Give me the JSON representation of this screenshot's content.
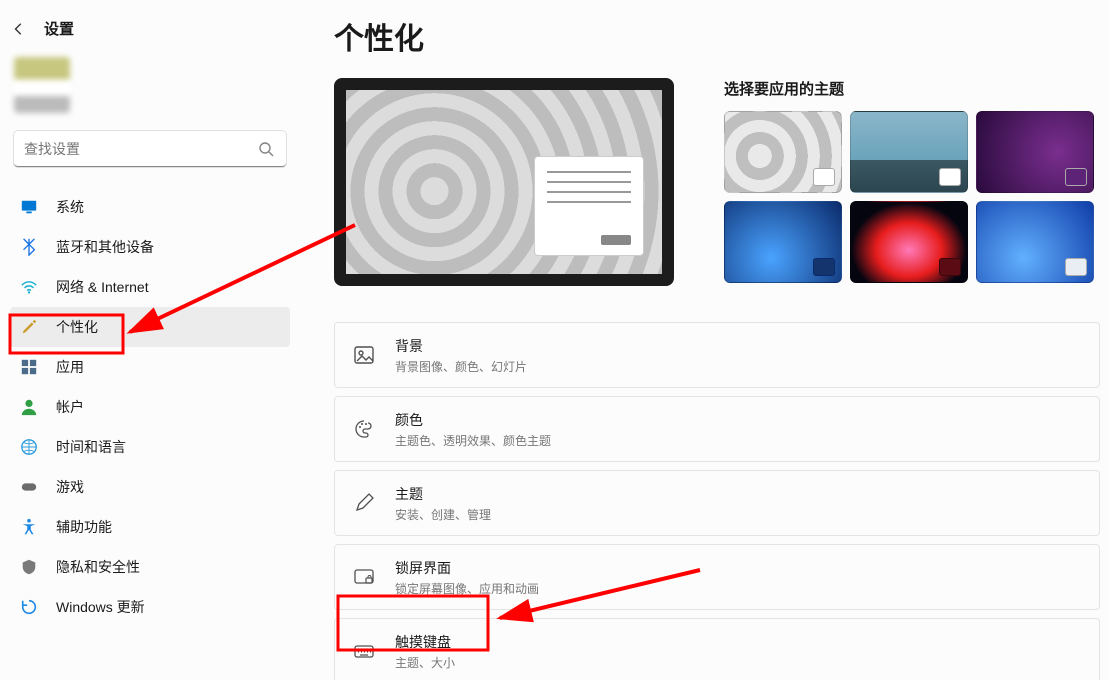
{
  "header": {
    "app_title": "设置"
  },
  "search": {
    "placeholder": "查找设置"
  },
  "sidebar": {
    "items": [
      {
        "key": "system",
        "label": "系统",
        "icon": "monitor-icon",
        "color": "#0078d4"
      },
      {
        "key": "bluetooth",
        "label": "蓝牙和其他设备",
        "icon": "bluetooth-icon",
        "color": "#1a73e8"
      },
      {
        "key": "network",
        "label": "网络 & Internet",
        "icon": "wifi-icon",
        "color": "#17b0d4"
      },
      {
        "key": "personalization",
        "label": "个性化",
        "icon": "paintbrush-icon",
        "color": "#c99d2f",
        "selected": true
      },
      {
        "key": "apps",
        "label": "应用",
        "icon": "apps-icon",
        "color": "#4a6b8a"
      },
      {
        "key": "accounts",
        "label": "帐户",
        "icon": "person-icon",
        "color": "#2f9e44"
      },
      {
        "key": "time",
        "label": "时间和语言",
        "icon": "globe-time-icon",
        "color": "#2d9cdb"
      },
      {
        "key": "gaming",
        "label": "游戏",
        "icon": "gamepad-icon",
        "color": "#6b6b6b"
      },
      {
        "key": "accessibility",
        "label": "辅助功能",
        "icon": "accessibility-icon",
        "color": "#1e88e5"
      },
      {
        "key": "privacy",
        "label": "隐私和安全性",
        "icon": "shield-icon",
        "color": "#7a7a7a"
      },
      {
        "key": "update",
        "label": "Windows 更新",
        "icon": "update-icon",
        "color": "#1e88e5"
      }
    ]
  },
  "page": {
    "title": "个性化"
  },
  "themes": {
    "heading": "选择要应用的主题"
  },
  "personalization_items": [
    {
      "key": "background",
      "title": "背景",
      "sub": "背景图像、颜色、幻灯片",
      "icon": "image-icon"
    },
    {
      "key": "colors",
      "title": "颜色",
      "sub": "主题色、透明效果、颜色主题",
      "icon": "palette-icon"
    },
    {
      "key": "themes",
      "title": "主题",
      "sub": "安装、创建、管理",
      "icon": "pen-icon"
    },
    {
      "key": "lockscreen",
      "title": "锁屏界面",
      "sub": "锁定屏幕图像、应用和动画",
      "icon": "lockscreen-icon"
    },
    {
      "key": "touchkeyboard",
      "title": "触摸键盘",
      "sub": "主题、大小",
      "icon": "keyboard-icon"
    }
  ]
}
